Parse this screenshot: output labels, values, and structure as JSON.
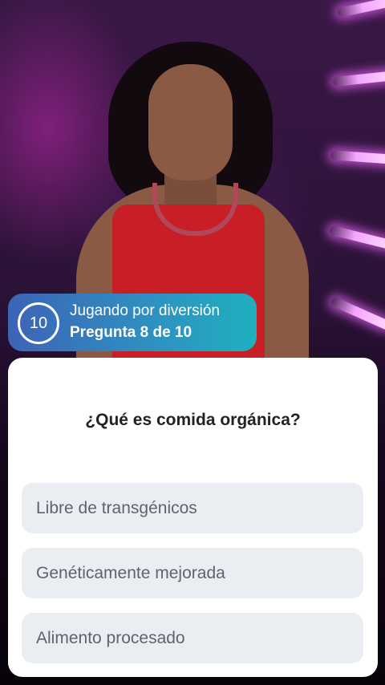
{
  "status": {
    "timer_value": "10",
    "mode": "Jugando por diversión",
    "progress": "Pregunta 8 de 10"
  },
  "quiz": {
    "question": "¿Qué es comida orgánica?",
    "answers": [
      "Libre de transgénicos",
      "Genéticamente mejorada",
      "Alimento procesado"
    ]
  },
  "colors": {
    "badge_start": "#3d63b6",
    "badge_end": "#1fb0bf",
    "answer_bg": "#eaeef2",
    "card_bg": "#ffffff"
  },
  "icons": {
    "timer": "circular-countdown-timer"
  }
}
